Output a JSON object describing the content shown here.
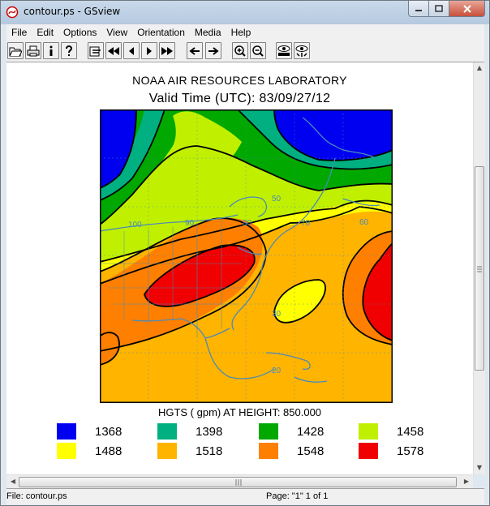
{
  "window": {
    "title": "contour.ps - GSview"
  },
  "menu": [
    "File",
    "Edit",
    "Options",
    "View",
    "Orientation",
    "Media",
    "Help"
  ],
  "document": {
    "header_line1": "NOAA AIR RESOURCES LABORATORY",
    "header_line2": "Valid Time (UTC): 83/09/27/12",
    "field_label": "HGTS ( gpm) AT HEIGHT:  850.000",
    "map_contour_labels": [
      "50",
      "70",
      "60",
      "100",
      "90",
      "80",
      "30",
      "20"
    ],
    "legend": [
      {
        "value": "1368",
        "color": "#0000f0"
      },
      {
        "value": "1398",
        "color": "#00b080"
      },
      {
        "value": "1428",
        "color": "#00a800"
      },
      {
        "value": "1458",
        "color": "#c0f000"
      },
      {
        "value": "1488",
        "color": "#ffff00"
      },
      {
        "value": "1518",
        "color": "#ffb400"
      },
      {
        "value": "1548",
        "color": "#ff8000"
      },
      {
        "value": "1578",
        "color": "#f00000"
      }
    ]
  },
  "status": {
    "file": "File: contour.ps",
    "page": "Page: \"1\"  1 of 1"
  }
}
